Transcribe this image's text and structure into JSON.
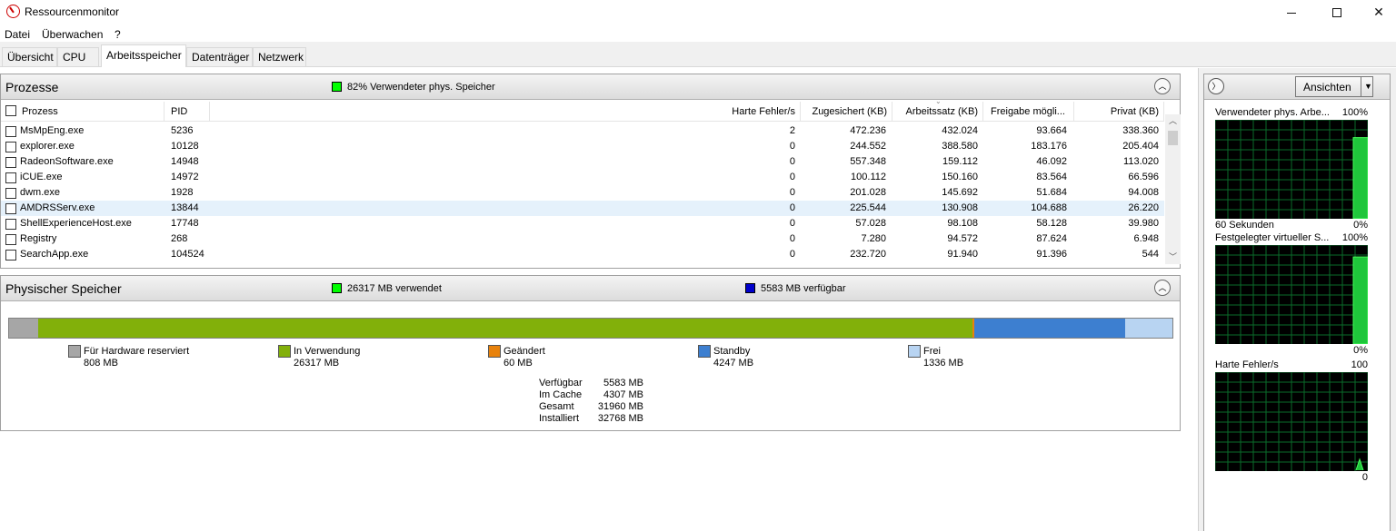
{
  "window": {
    "title": "Ressourcenmonitor",
    "minimize": "—",
    "close": "✕"
  },
  "menu": [
    "Datei",
    "Überwachen",
    "?"
  ],
  "tabs": [
    "Übersicht",
    "CPU",
    "Arbeitsspeicher",
    "Datenträger",
    "Netzwerk"
  ],
  "active_tab": "Arbeitsspeicher",
  "colors": {
    "used": "#00ff00",
    "available": "#0000cc",
    "hardware": "#a6a6a6",
    "in_use": "#82b00a",
    "modified": "#e8820c",
    "standby": "#3d7fd0",
    "free": "#b8d4f2"
  },
  "processes": {
    "title": "Prozesse",
    "summary": "82% Verwendeter phys. Speicher",
    "columns": [
      "Prozess",
      "PID",
      "Harte Fehler/s",
      "Zugesichert (KB)",
      "Arbeitssatz (KB)",
      "Freigabe mögli...",
      "Privat (KB)"
    ],
    "rows": [
      {
        "name": "MsMpEng.exe",
        "pid": "5236",
        "faults": "2",
        "commit": "472.236",
        "ws": "432.024",
        "share": "93.664",
        "priv": "338.360"
      },
      {
        "name": "explorer.exe",
        "pid": "10128",
        "faults": "0",
        "commit": "244.552",
        "ws": "388.580",
        "share": "183.176",
        "priv": "205.404"
      },
      {
        "name": "RadeonSoftware.exe",
        "pid": "14948",
        "faults": "0",
        "commit": "557.348",
        "ws": "159.112",
        "share": "46.092",
        "priv": "113.020"
      },
      {
        "name": "iCUE.exe",
        "pid": "14972",
        "faults": "0",
        "commit": "100.112",
        "ws": "150.160",
        "share": "83.564",
        "priv": "66.596"
      },
      {
        "name": "dwm.exe",
        "pid": "1928",
        "faults": "0",
        "commit": "201.028",
        "ws": "145.692",
        "share": "51.684",
        "priv": "94.008"
      },
      {
        "name": "AMDRSServ.exe",
        "pid": "13844",
        "faults": "0",
        "commit": "225.544",
        "ws": "130.908",
        "share": "104.688",
        "priv": "26.220"
      },
      {
        "name": "ShellExperienceHost.exe",
        "pid": "17748",
        "faults": "0",
        "commit": "57.028",
        "ws": "98.108",
        "share": "58.128",
        "priv": "39.980"
      },
      {
        "name": "Registry",
        "pid": "268",
        "faults": "0",
        "commit": "7.280",
        "ws": "94.572",
        "share": "87.624",
        "priv": "6.948"
      },
      {
        "name": "SearchApp.exe",
        "pid": "104524",
        "faults": "0",
        "commit": "232.720",
        "ws": "91.940",
        "share": "91.396",
        "priv": "544"
      }
    ],
    "selected_row": "AMDRSServ.exe"
  },
  "physical": {
    "title": "Physischer Speicher",
    "used_label": "26317 MB verwendet",
    "available_label": "5583 MB verfügbar",
    "bar": [
      {
        "key": "hardware",
        "mb": 808
      },
      {
        "key": "in_use",
        "mb": 26317
      },
      {
        "key": "modified",
        "mb": 60
      },
      {
        "key": "standby",
        "mb": 4247
      },
      {
        "key": "free",
        "mb": 1336
      }
    ],
    "legend": [
      {
        "label": "Für Hardware reserviert",
        "value": "808 MB",
        "color": "#a6a6a6"
      },
      {
        "label": "In Verwendung",
        "value": "26317 MB",
        "color": "#82b00a"
      },
      {
        "label": "Geändert",
        "value": "60 MB",
        "color": "#e8820c"
      },
      {
        "label": "Standby",
        "value": "4247 MB",
        "color": "#3d7fd0"
      },
      {
        "label": "Frei",
        "value": "1336 MB",
        "color": "#b8d4f2"
      }
    ],
    "stats": [
      {
        "label": "Verfügbar",
        "value": "5583 MB"
      },
      {
        "label": "Im Cache",
        "value": "4307 MB"
      },
      {
        "label": "Gesamt",
        "value": "31960 MB"
      },
      {
        "label": "Installiert",
        "value": "32768 MB"
      }
    ]
  },
  "graphs": {
    "views_label": "Ansichten",
    "charts": [
      {
        "title": "Verwendeter phys. Arbe...",
        "max": "100%",
        "min": "0%",
        "foot": "60 Sekunden",
        "level": 0.82
      },
      {
        "title": "Festgelegter virtueller S...",
        "max": "100%",
        "min": "0%",
        "foot": "",
        "level": 0.88
      },
      {
        "title": "Harte Fehler/s",
        "max": "100",
        "min": "0",
        "foot": "",
        "level": 0.02
      }
    ]
  }
}
